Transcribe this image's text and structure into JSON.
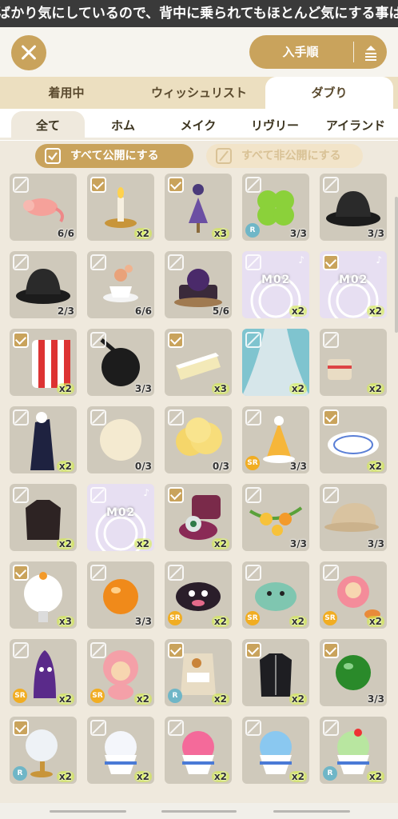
{
  "banner_text": "ばかり気にしているので、背中に乗られてもほとんど気にする事はない",
  "sort_label": "入手順",
  "tabs": [
    "着用中",
    "ウィッシュリスト",
    "ダブり"
  ],
  "subtabs": [
    "全て",
    "ホム",
    "メイク",
    "リヴリー",
    "アイランド"
  ],
  "filters": {
    "public": "すべて公開にする",
    "private": "すべて非公開にする"
  },
  "colors": {
    "accent": "#c9a35c",
    "tab_bg": "#ecdfc0",
    "grid_bg": "#efe9dd",
    "count_highlight": "#d5f23a",
    "rarity_R": "#6fb6c7",
    "rarity_SR": "#f1ad22"
  },
  "items": [
    {
      "icon": "shrimp-icon",
      "checked": false,
      "count": "6/6",
      "rarity": ""
    },
    {
      "icon": "candle-lamp-icon",
      "checked": true,
      "count": "x2",
      "rarity": ""
    },
    {
      "icon": "dress-mannequin-icon",
      "checked": true,
      "count": "x3",
      "rarity": ""
    },
    {
      "icon": "clover-icon",
      "checked": false,
      "count": "3/3",
      "rarity": "R"
    },
    {
      "icon": "bowler-hat-icon",
      "checked": false,
      "count": "3/3",
      "rarity": ""
    },
    {
      "icon": "bowler-hat-icon",
      "checked": false,
      "count": "2/3",
      "rarity": ""
    },
    {
      "icon": "teacup-icon",
      "checked": false,
      "count": "6/6",
      "rarity": ""
    },
    {
      "icon": "dark-rose-cake-icon",
      "checked": false,
      "count": "5/6",
      "rarity": ""
    },
    {
      "icon": "m02-stage-icon",
      "checked": false,
      "count": "x2",
      "rarity": "",
      "tag": "M02"
    },
    {
      "icon": "m02-stage-icon",
      "checked": true,
      "count": "x2",
      "rarity": "",
      "tag": "M02"
    },
    {
      "icon": "striped-chair-icon",
      "checked": true,
      "count": "x2",
      "rarity": ""
    },
    {
      "icon": "frying-pan-icon",
      "checked": false,
      "count": "3/3",
      "rarity": ""
    },
    {
      "icon": "cake-slice-icon",
      "checked": true,
      "count": "x3",
      "rarity": ""
    },
    {
      "icon": "curtain-icon",
      "checked": false,
      "count": "x2",
      "rarity": ""
    },
    {
      "icon": "moon-drum-icon",
      "checked": false,
      "count": "x2",
      "rarity": ""
    },
    {
      "icon": "starry-robe-icon",
      "checked": false,
      "count": "x2",
      "rarity": ""
    },
    {
      "icon": "moon-glow-icon",
      "checked": false,
      "count": "0/3",
      "rarity": ""
    },
    {
      "icon": "yellow-cloud-icon",
      "checked": false,
      "count": "0/3",
      "rarity": ""
    },
    {
      "icon": "party-hat-icon",
      "checked": false,
      "count": "3/3",
      "rarity": "SR"
    },
    {
      "icon": "plate-icon",
      "checked": true,
      "count": "x2",
      "rarity": ""
    },
    {
      "icon": "jacket-icon",
      "checked": false,
      "count": "x2",
      "rarity": ""
    },
    {
      "icon": "m02-stage-icon",
      "checked": false,
      "count": "x2",
      "rarity": "",
      "tag": "M02"
    },
    {
      "icon": "eye-ring-box-icon",
      "checked": true,
      "count": "x2",
      "rarity": ""
    },
    {
      "icon": "flower-garland-icon",
      "checked": false,
      "count": "3/3",
      "rarity": ""
    },
    {
      "icon": "cap-icon",
      "checked": false,
      "count": "3/3",
      "rarity": ""
    },
    {
      "icon": "snow-globe-icon",
      "checked": true,
      "count": "x3",
      "rarity": ""
    },
    {
      "icon": "orange-jelly-icon",
      "checked": false,
      "count": "3/3",
      "rarity": ""
    },
    {
      "icon": "dark-creature-icon",
      "checked": false,
      "count": "x2",
      "rarity": "SR"
    },
    {
      "icon": "green-creature-icon",
      "checked": false,
      "count": "x2",
      "rarity": "SR"
    },
    {
      "icon": "pink-creature-icon",
      "checked": false,
      "count": "x2",
      "rarity": "SR"
    },
    {
      "icon": "purple-creature-icon",
      "checked": false,
      "count": "x2",
      "rarity": "SR"
    },
    {
      "icon": "pink-bear-icon",
      "checked": false,
      "count": "x2",
      "rarity": "SR"
    },
    {
      "icon": "coffee-bag-icon",
      "checked": true,
      "count": "x2",
      "rarity": "R"
    },
    {
      "icon": "black-jacket-icon",
      "checked": true,
      "count": "x2",
      "rarity": ""
    },
    {
      "icon": "green-ball-icon",
      "checked": true,
      "count": "3/3",
      "rarity": ""
    },
    {
      "icon": "crystal-lamp-icon",
      "checked": true,
      "count": "x2",
      "rarity": "R"
    },
    {
      "icon": "shaved-ice-icon",
      "checked": false,
      "count": "x2",
      "rarity": ""
    },
    {
      "icon": "shaved-ice-pink-icon",
      "checked": false,
      "count": "x2",
      "rarity": ""
    },
    {
      "icon": "shaved-ice-blue-icon",
      "checked": false,
      "count": "x2",
      "rarity": ""
    },
    {
      "icon": "shaved-ice-rainbow-icon",
      "checked": false,
      "count": "x2",
      "rarity": "R"
    }
  ]
}
